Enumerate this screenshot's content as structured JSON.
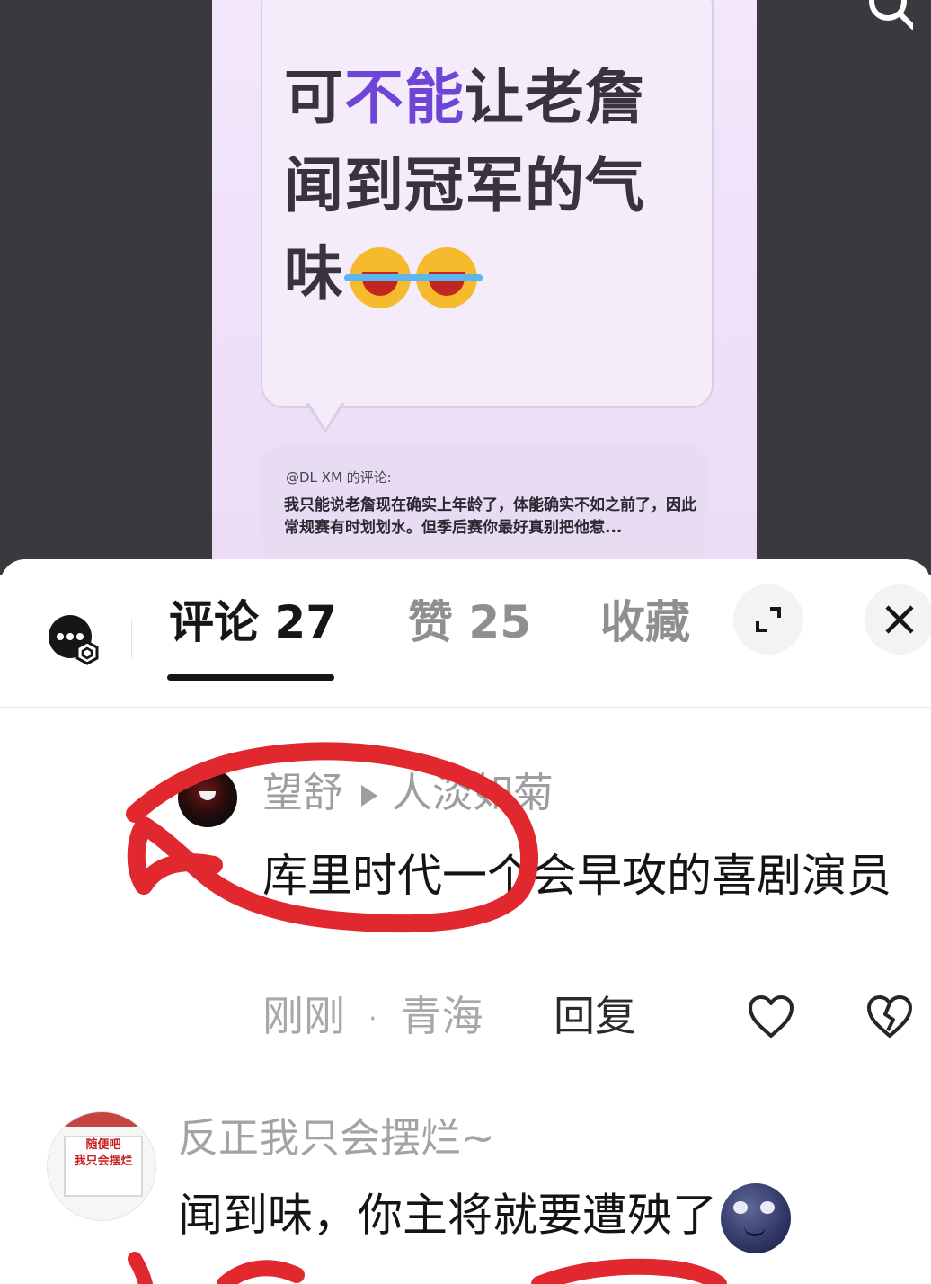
{
  "post": {
    "headline_part1": "可",
    "headline_accent": "不能",
    "headline_part2": "让老詹闻到冠军的气味",
    "headline_emojis": [
      "loudly-crying-face",
      "loudly-crying-face"
    ],
    "quote_author": "@DL  XM 的评论:",
    "quote_text": "我只能说老詹现在确实上年龄了，体能确实不如之前了，因此常规赛有时划划水。但季后赛你最好真别把他惹..."
  },
  "tabs": {
    "comments_label": "评论 27",
    "likes_label": "赞 25",
    "favorites_label": "收藏"
  },
  "comments": [
    {
      "author": "望舒",
      "reply_to": "人淡如菊",
      "text": "库里时代一个会早攻的喜剧演员",
      "time": "刚刚",
      "location": "青海",
      "reply_label": "回复"
    },
    {
      "author": "反正我只会摆烂~",
      "text": "闻到味，你主将就要遭殃了",
      "emoji": "new-moon-face",
      "avatar_sign_line1": "随便吧",
      "avatar_sign_line2": "我只会摆烂"
    }
  ],
  "colors": {
    "accent_purple": "#6f45d6",
    "annotation_red": "#e0282e"
  }
}
